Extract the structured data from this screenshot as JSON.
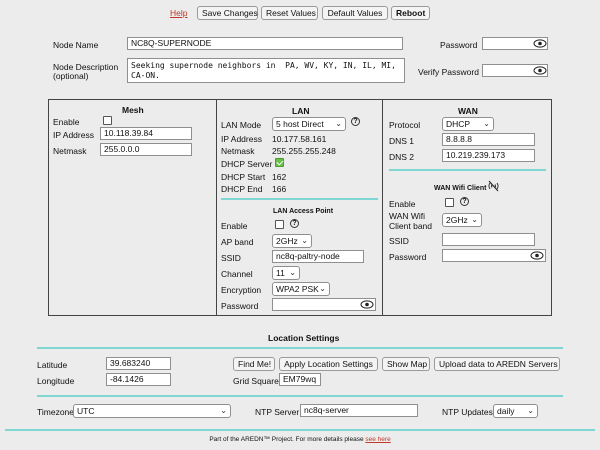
{
  "toolbar": {
    "help": "Help",
    "save": "Save Changes",
    "reset": "Reset Values",
    "defaults": "Default Values",
    "reboot": "Reboot"
  },
  "node": {
    "name_label": "Node Name",
    "name_value": "NC8Q-SUPERNODE",
    "desc_label": "Node Description",
    "desc_label2": "(optional)",
    "desc_value": "Seeking supernode neighbors in  PA, WV, KY, IN, IL, MI, CA-ON.",
    "password_label": "Password",
    "verify_label": "Verify Password"
  },
  "mesh": {
    "title": "Mesh",
    "enable_label": "Enable",
    "ip_label": "IP Address",
    "ip_value": "10.118.39.84",
    "netmask_label": "Netmask",
    "netmask_value": "255.0.0.0"
  },
  "lan": {
    "title": "LAN",
    "mode_label": "LAN Mode",
    "mode_value": "5 host Direct",
    "ip_label": "IP Address",
    "ip_value": "10.177.58.161",
    "netmask_label": "Netmask",
    "netmask_value": "255.255.255.248",
    "dhcp_label": "DHCP Server",
    "dhcp_start_label": "DHCP Start",
    "dhcp_start_value": "162",
    "dhcp_end_label": "DHCP End",
    "dhcp_end_value": "166",
    "ap_title": "LAN Access Point",
    "ap_enable_label": "Enable",
    "ap_band_label": "AP band",
    "ap_band_value": "2GHz",
    "ssid_label": "SSID",
    "ssid_value": "nc8q-paltry-node",
    "channel_label": "Channel",
    "channel_value": "11",
    "encryption_label": "Encryption",
    "encryption_value": "WPA2 PSK",
    "password_label": "Password"
  },
  "wan": {
    "title": "WAN",
    "protocol_label": "Protocol",
    "protocol_value": "DHCP",
    "dns1_label": "DNS 1",
    "dns1_value": "8.8.8.8",
    "dns2_label": "DNS 2",
    "dns2_value": "10.219.239.173",
    "client_title": "WAN Wifi Client",
    "enable_label": "Enable",
    "band_label1": "WAN Wifi",
    "band_label2": "Client band",
    "band_value": "2GHz",
    "ssid_label": "SSID",
    "password_label": "Password"
  },
  "location": {
    "title": "Location Settings",
    "lat_label": "Latitude",
    "lat_value": "39.683240",
    "lon_label": "Longitude",
    "lon_value": "-84.1426",
    "find_me": "Find Me!",
    "apply": "Apply Location Settings",
    "show_map": "Show Map",
    "upload": "Upload data to AREDN Servers",
    "grid_label": "Grid Square",
    "grid_value": "EM79wq"
  },
  "time": {
    "timezone_label": "Timezone",
    "timezone_value": "UTC",
    "ntp_label": "NTP Server",
    "ntp_value": "nc8q-server",
    "ntp_updates_label": "NTP Updates",
    "ntp_updates_value": "daily"
  },
  "footer": {
    "text": "Part of the AREDN™ Project. For more details please ",
    "link": "see here"
  },
  "colors": {
    "accent_line": "#7fd6d3",
    "help_link": "#c0392b",
    "checkbox_checked": "#6abf4b"
  }
}
